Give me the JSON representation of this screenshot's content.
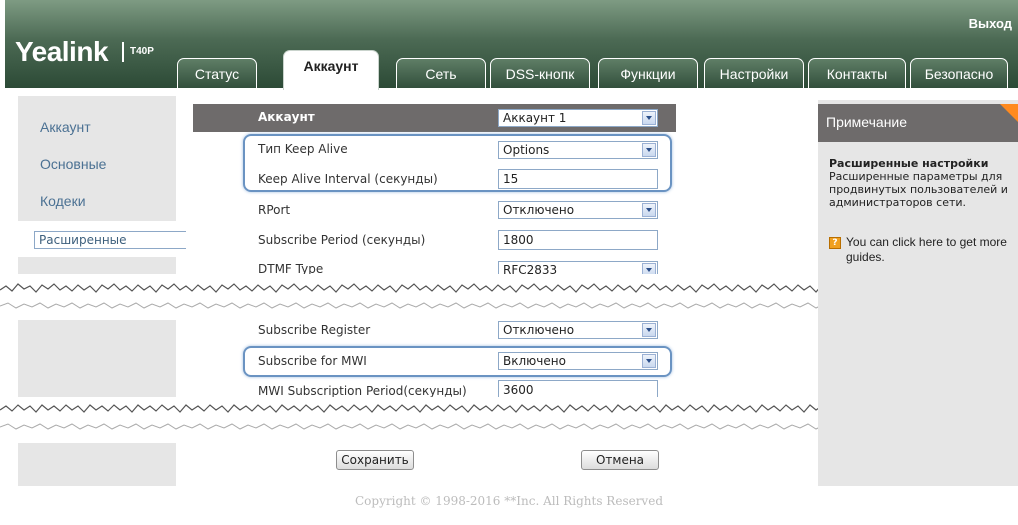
{
  "header": {
    "logo": "Yealink",
    "model": "T40P",
    "logout": "Выход",
    "tabs": [
      "Статус",
      "Аккаунт",
      "Сеть",
      "DSS-кнопк",
      "Функции",
      "Настройки",
      "Контакты",
      "Безопасно"
    ],
    "active_tab": "Аккаунт"
  },
  "sidebar": {
    "items": [
      "Аккаунт",
      "Основные",
      "Кодеки",
      "Расширенные"
    ],
    "selected": "Расширенные"
  },
  "form": {
    "account_label": "Аккаунт",
    "account_value": "Аккаунт 1",
    "keep_alive_type_label": "Тип Keep Alive",
    "keep_alive_type_value": "Options",
    "keep_alive_interval_label": "Keep Alive Interval (секунды)",
    "keep_alive_interval_value": "15",
    "rport_label": "RPort",
    "rport_value": "Отключено",
    "subscribe_period_label": "Subscribe Period (секунды)",
    "subscribe_period_value": "1800",
    "dtmf_type_label": "DTMF Type",
    "dtmf_type_value": "RFC2833",
    "subscribe_register_label": "Subscribe Register",
    "subscribe_register_value": "Отключено",
    "subscribe_mwi_label": "Subscribe for MWI",
    "subscribe_mwi_value": "Включено",
    "mwi_period_label": "MWI Subscription Period(секунды)",
    "mwi_period_value": "3600",
    "save_label": "Сохранить",
    "cancel_label": "Отмена"
  },
  "note": {
    "title": "Примечание",
    "heading": "Расширенные настройки",
    "text": "Расширенные параметры для продвинутых пользователей и администраторов сети.",
    "guide": "You can click here to get more guides."
  },
  "footer": {
    "copyright": "Copyright © 1998-2016 **Inc. All Rights Reserved"
  },
  "colors": {
    "header_green": "#3d5c47",
    "nav_link": "#4b7193",
    "highlight_border": "#6a93c2",
    "note_corner": "#ff8a1f"
  }
}
